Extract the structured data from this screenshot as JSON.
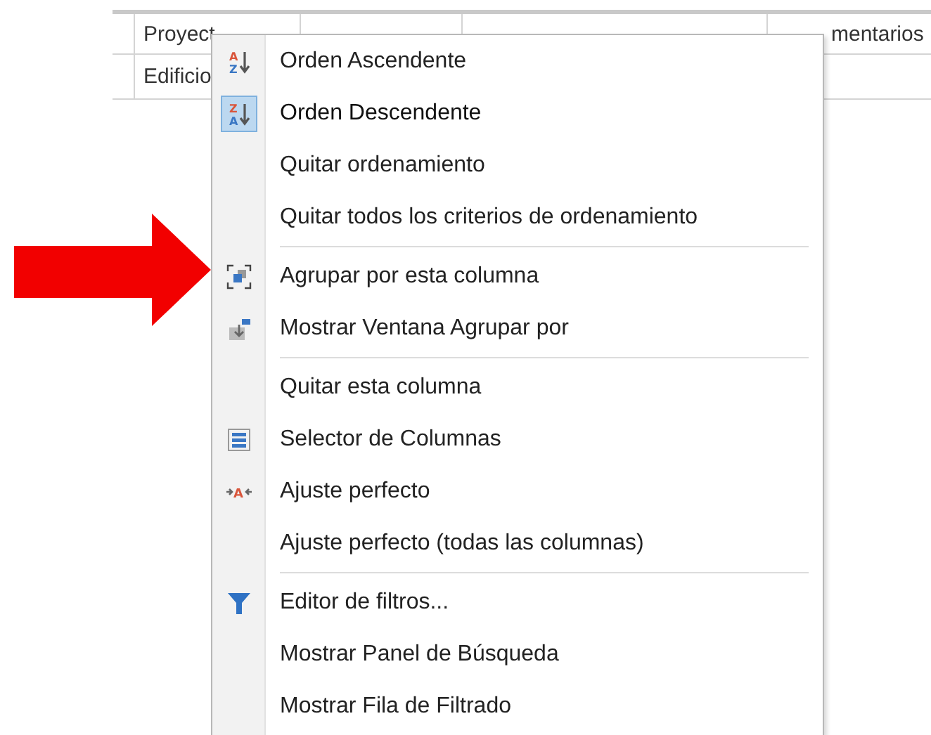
{
  "grid": {
    "columns": [
      {
        "label": "Proyect"
      },
      {},
      {},
      {
        "label": "mentarios"
      }
    ],
    "rows": [
      [
        "Edificio",
        "",
        "",
        ""
      ]
    ]
  },
  "context_menu": {
    "items": [
      {
        "label": "Orden Ascendente",
        "icon_letters": [
          "A",
          "Z"
        ],
        "selected": false,
        "separator_after": false
      },
      {
        "label": "Orden Descendente",
        "icon_letters": [
          "Z",
          "A"
        ],
        "selected": true,
        "separator_after": false
      },
      {
        "label": "Quitar ordenamiento",
        "selected": false,
        "separator_after": false
      },
      {
        "label": "Quitar todos los criterios de ordenamiento",
        "selected": false,
        "separator_after": true
      },
      {
        "label": "Agrupar por esta columna",
        "selected": false,
        "separator_after": false
      },
      {
        "label": "Mostrar Ventana Agrupar por",
        "selected": false,
        "separator_after": true
      },
      {
        "label": "Quitar esta columna",
        "selected": false,
        "separator_after": false
      },
      {
        "label": "Selector de Columnas",
        "selected": false,
        "separator_after": false
      },
      {
        "label": "Ajuste perfecto",
        "icon_letters": [
          "A"
        ],
        "selected": false,
        "separator_after": false
      },
      {
        "label": "Ajuste perfecto (todas las columnas)",
        "selected": false,
        "separator_after": true
      },
      {
        "label": "Editor de filtros...",
        "selected": false,
        "separator_after": false
      },
      {
        "label": "Mostrar Panel de Búsqueda",
        "selected": false,
        "separator_after": false
      },
      {
        "label": "Mostrar Fila de Filtrado",
        "selected": false,
        "separator_after": false
      }
    ]
  }
}
